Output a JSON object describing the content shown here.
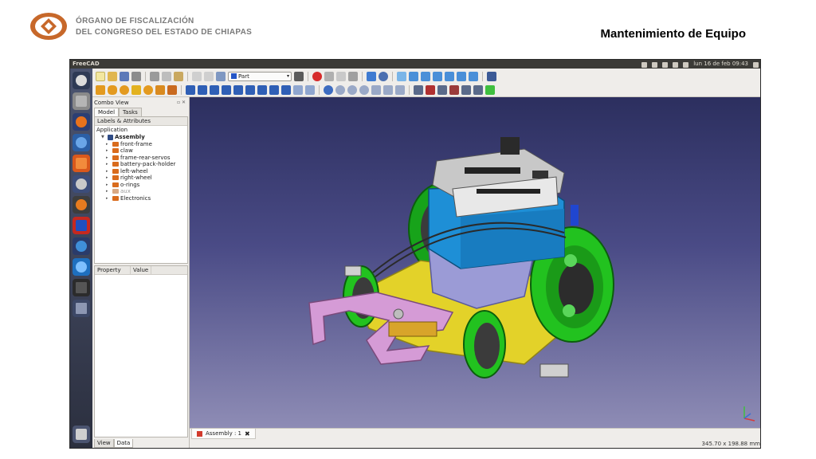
{
  "slide": {
    "org_line1": "ÓRGANO DE FISCALIZACIÓN",
    "org_line2": "DEL CONGRESO DEL ESTADO DE CHIAPAS",
    "title": "Mantenimiento de Equipo"
  },
  "app": {
    "window_title": "FreeCAD",
    "clock": "lun 16 de feb 09:43",
    "workbench": "Part"
  },
  "combo_view": {
    "title": "Combo View",
    "tabs": [
      "Model",
      "Tasks"
    ],
    "tree_header": "Labels & Attributes",
    "application_label": "Application",
    "root_item": "Assembly",
    "items": [
      {
        "label": "front-frame",
        "muted": false
      },
      {
        "label": "claw",
        "muted": false
      },
      {
        "label": "frame-rear-servos",
        "muted": false
      },
      {
        "label": "battery-pack-holder",
        "muted": false
      },
      {
        "label": "left-wheel",
        "muted": false
      },
      {
        "label": "right-wheel",
        "muted": false
      },
      {
        "label": "o-rings",
        "muted": false
      },
      {
        "label": "aux",
        "muted": true
      },
      {
        "label": "Electronics",
        "muted": false
      }
    ],
    "property_columns": [
      "Property",
      "Value"
    ],
    "bottom_tabs": [
      "View",
      "Data"
    ]
  },
  "document_tab": {
    "label": "Assembly : 1",
    "close_symbol": "✖"
  },
  "status_bar": {
    "dimensions": "345.70 x 198.88 mm"
  },
  "colors": {
    "background_top": "#2c2f5f",
    "background_bottom": "#8e8cb5",
    "board_green": "#22c21f",
    "chassis_yellow": "#e3d229",
    "frame_blue": "#1e8fd6",
    "claw_pink": "#d59bd6"
  }
}
